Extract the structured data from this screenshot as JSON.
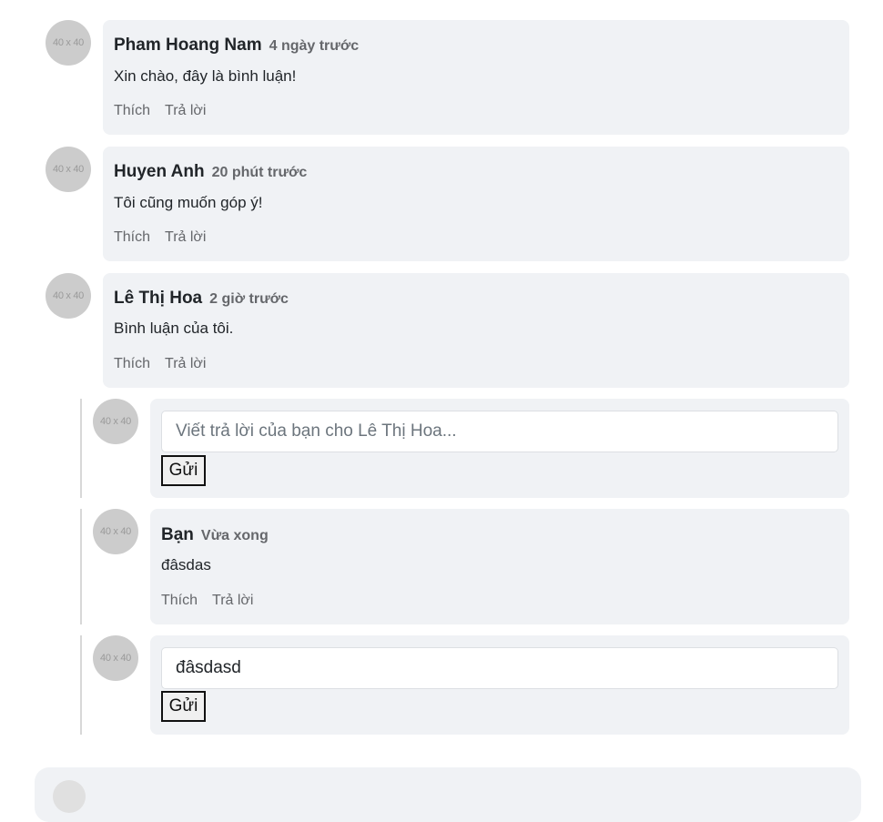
{
  "avatar_placeholder": "40 x 40",
  "comments": [
    {
      "name": "Pham Hoang Nam",
      "time": "4 ngày trước",
      "text": "Xin chào, đây là bình luận!",
      "like": "Thích",
      "reply": "Trả lời"
    },
    {
      "name": "Huyen Anh",
      "time": "20 phút trước",
      "text": "Tôi cũng muốn góp ý!",
      "like": "Thích",
      "reply": "Trả lời"
    },
    {
      "name": "Lê Thị Hoa",
      "time": "2 giờ trước",
      "text": "Bình luận của tôi.",
      "like": "Thích",
      "reply": "Trả lời"
    }
  ],
  "reply_form_1": {
    "placeholder": "Viết trả lời của bạn cho Lê Thị Hoa...",
    "value": "",
    "send": "Gửi"
  },
  "reply": {
    "name": "Bạn",
    "time": "Vừa xong",
    "text": "đâsdas",
    "like": "Thích",
    "reply": "Trả lời"
  },
  "reply_form_2": {
    "value": "đâsdasd",
    "send": "Gửi"
  },
  "colors": {
    "bubble": "#f0f2f5",
    "avatar": "#cccccc",
    "muted": "#65676b"
  }
}
